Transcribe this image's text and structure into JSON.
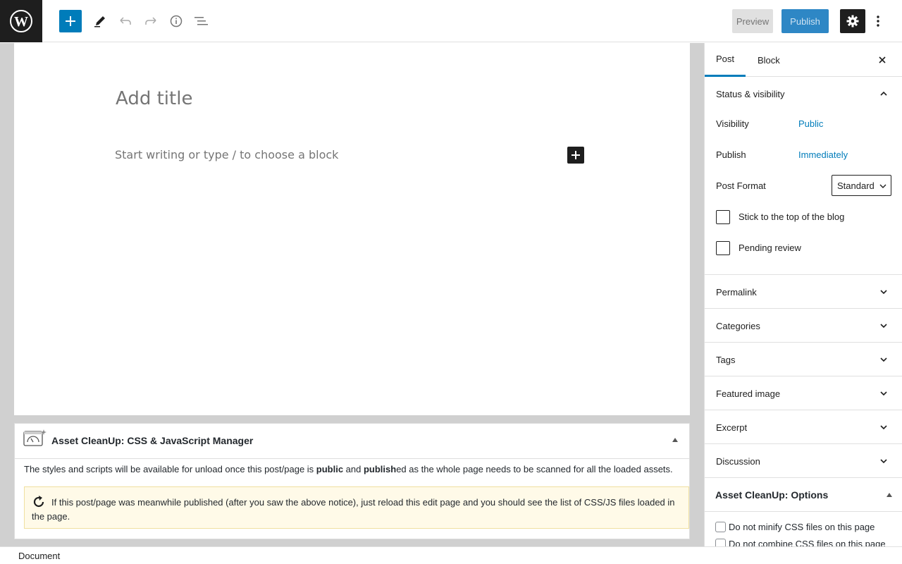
{
  "toolbar": {
    "preview_label": "Preview",
    "publish_label": "Publish"
  },
  "editor": {
    "title_placeholder": "Add title",
    "body_placeholder": "Start writing or type / to choose a block"
  },
  "meta_box": {
    "title": "Asset CleanUp: CSS & JavaScript Manager",
    "text_pre": "The styles and scripts will be available for unload once this post/page is ",
    "text_bold1": "public",
    "text_mid": " and ",
    "text_bold2": "publish",
    "text_post": "ed as the whole page needs to be scanned for all the loaded assets.",
    "notice": "If this post/page was meanwhile published (after you saw the above notice), just reload this edit page and you should see the list of CSS/JS files loaded in the page."
  },
  "sidebar": {
    "tabs": [
      {
        "label": "Post",
        "active": true
      },
      {
        "label": "Block",
        "active": false
      }
    ],
    "status_panel": {
      "title": "Status & visibility",
      "visibility_label": "Visibility",
      "visibility_value": "Public",
      "publish_label": "Publish",
      "publish_value": "Immediately",
      "format_label": "Post Format",
      "format_value": "Standard",
      "sticky_label": "Stick to the top of the blog",
      "pending_label": "Pending review"
    },
    "panels": [
      {
        "label": "Permalink"
      },
      {
        "label": "Categories"
      },
      {
        "label": "Tags"
      },
      {
        "label": "Featured image"
      },
      {
        "label": "Excerpt"
      },
      {
        "label": "Discussion"
      }
    ],
    "asset_cleanup": {
      "title": "Asset CleanUp: Options",
      "option1": "Do not minify CSS files on this page",
      "option2": "Do not combine CSS files on this page"
    }
  },
  "footer": {
    "breadcrumb": "Document"
  },
  "colors": {
    "accent": "#007cba",
    "dark": "#1e1e1e"
  }
}
